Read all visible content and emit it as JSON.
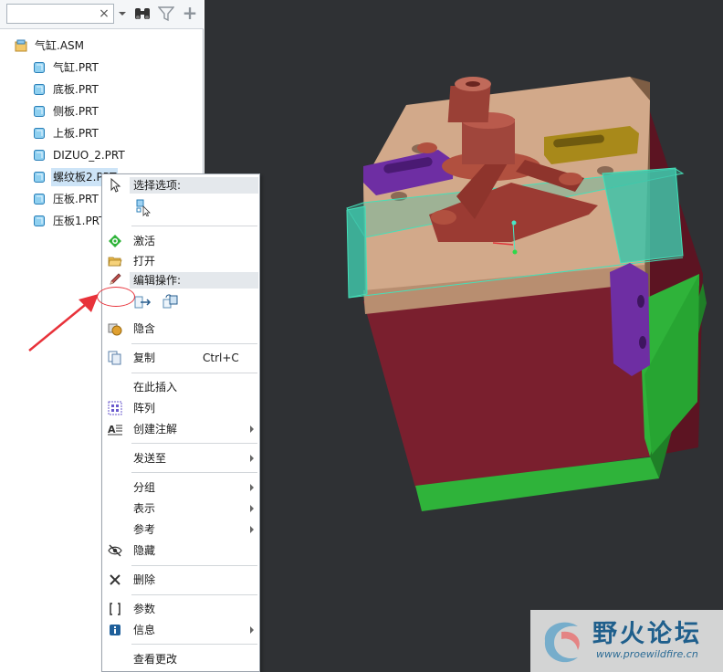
{
  "search": {
    "placeholder": "",
    "value": "",
    "clear_glyph": "×"
  },
  "toolbar": {
    "dropdown_icon": "chevron-down-icon",
    "find_icon": "binoculars-icon",
    "filter_icon": "filter-icon",
    "add_glyph": "+"
  },
  "tree": {
    "root": {
      "label": "气缸.ASM",
      "icon": "assembly-icon"
    },
    "items": [
      {
        "label": "气缸.PRT",
        "icon": "part-icon"
      },
      {
        "label": "底板.PRT",
        "icon": "part-icon"
      },
      {
        "label": "侧板.PRT",
        "icon": "part-icon"
      },
      {
        "label": "上板.PRT",
        "icon": "part-icon"
      },
      {
        "label": "DIZUO_2.PRT",
        "icon": "part-small-icon"
      },
      {
        "label": "螺纹板2.PRT",
        "icon": "part-icon",
        "selected": true
      },
      {
        "label": "压板.PRT",
        "icon": "part-icon"
      },
      {
        "label": "压板1.PRT",
        "icon": "part-icon"
      }
    ]
  },
  "context_menu": {
    "select_options_header": "选择选项:",
    "activate": "激活",
    "open": "打开",
    "edit_ops_header": "编辑操作:",
    "hide_in_view": "隐含",
    "copy": "复制",
    "copy_shortcut": "Ctrl+C",
    "insert_here": "在此插入",
    "pattern": "阵列",
    "create_annotation": "创建注解",
    "send_to": "发送至",
    "group": "分组",
    "represent": "表示",
    "reference": "参考",
    "hide": "隐藏",
    "delete": "删除",
    "parameters": "参数",
    "info": "信息",
    "view_changes": "查看更改"
  },
  "watermark": {
    "title": "野火论坛",
    "url": "www.proewildfire.cn"
  },
  "colors": {
    "viewport_bg": "#2f3134",
    "annotation_red": "#e8323a",
    "part_tan": "#d2a98a",
    "part_maroon": "#7a1f2e",
    "part_green": "#2fb33a",
    "part_purple": "#6e2ea3",
    "part_olive": "#a8891a",
    "part_teal": "#3fc3a8",
    "part_copper": "#a0463c"
  }
}
